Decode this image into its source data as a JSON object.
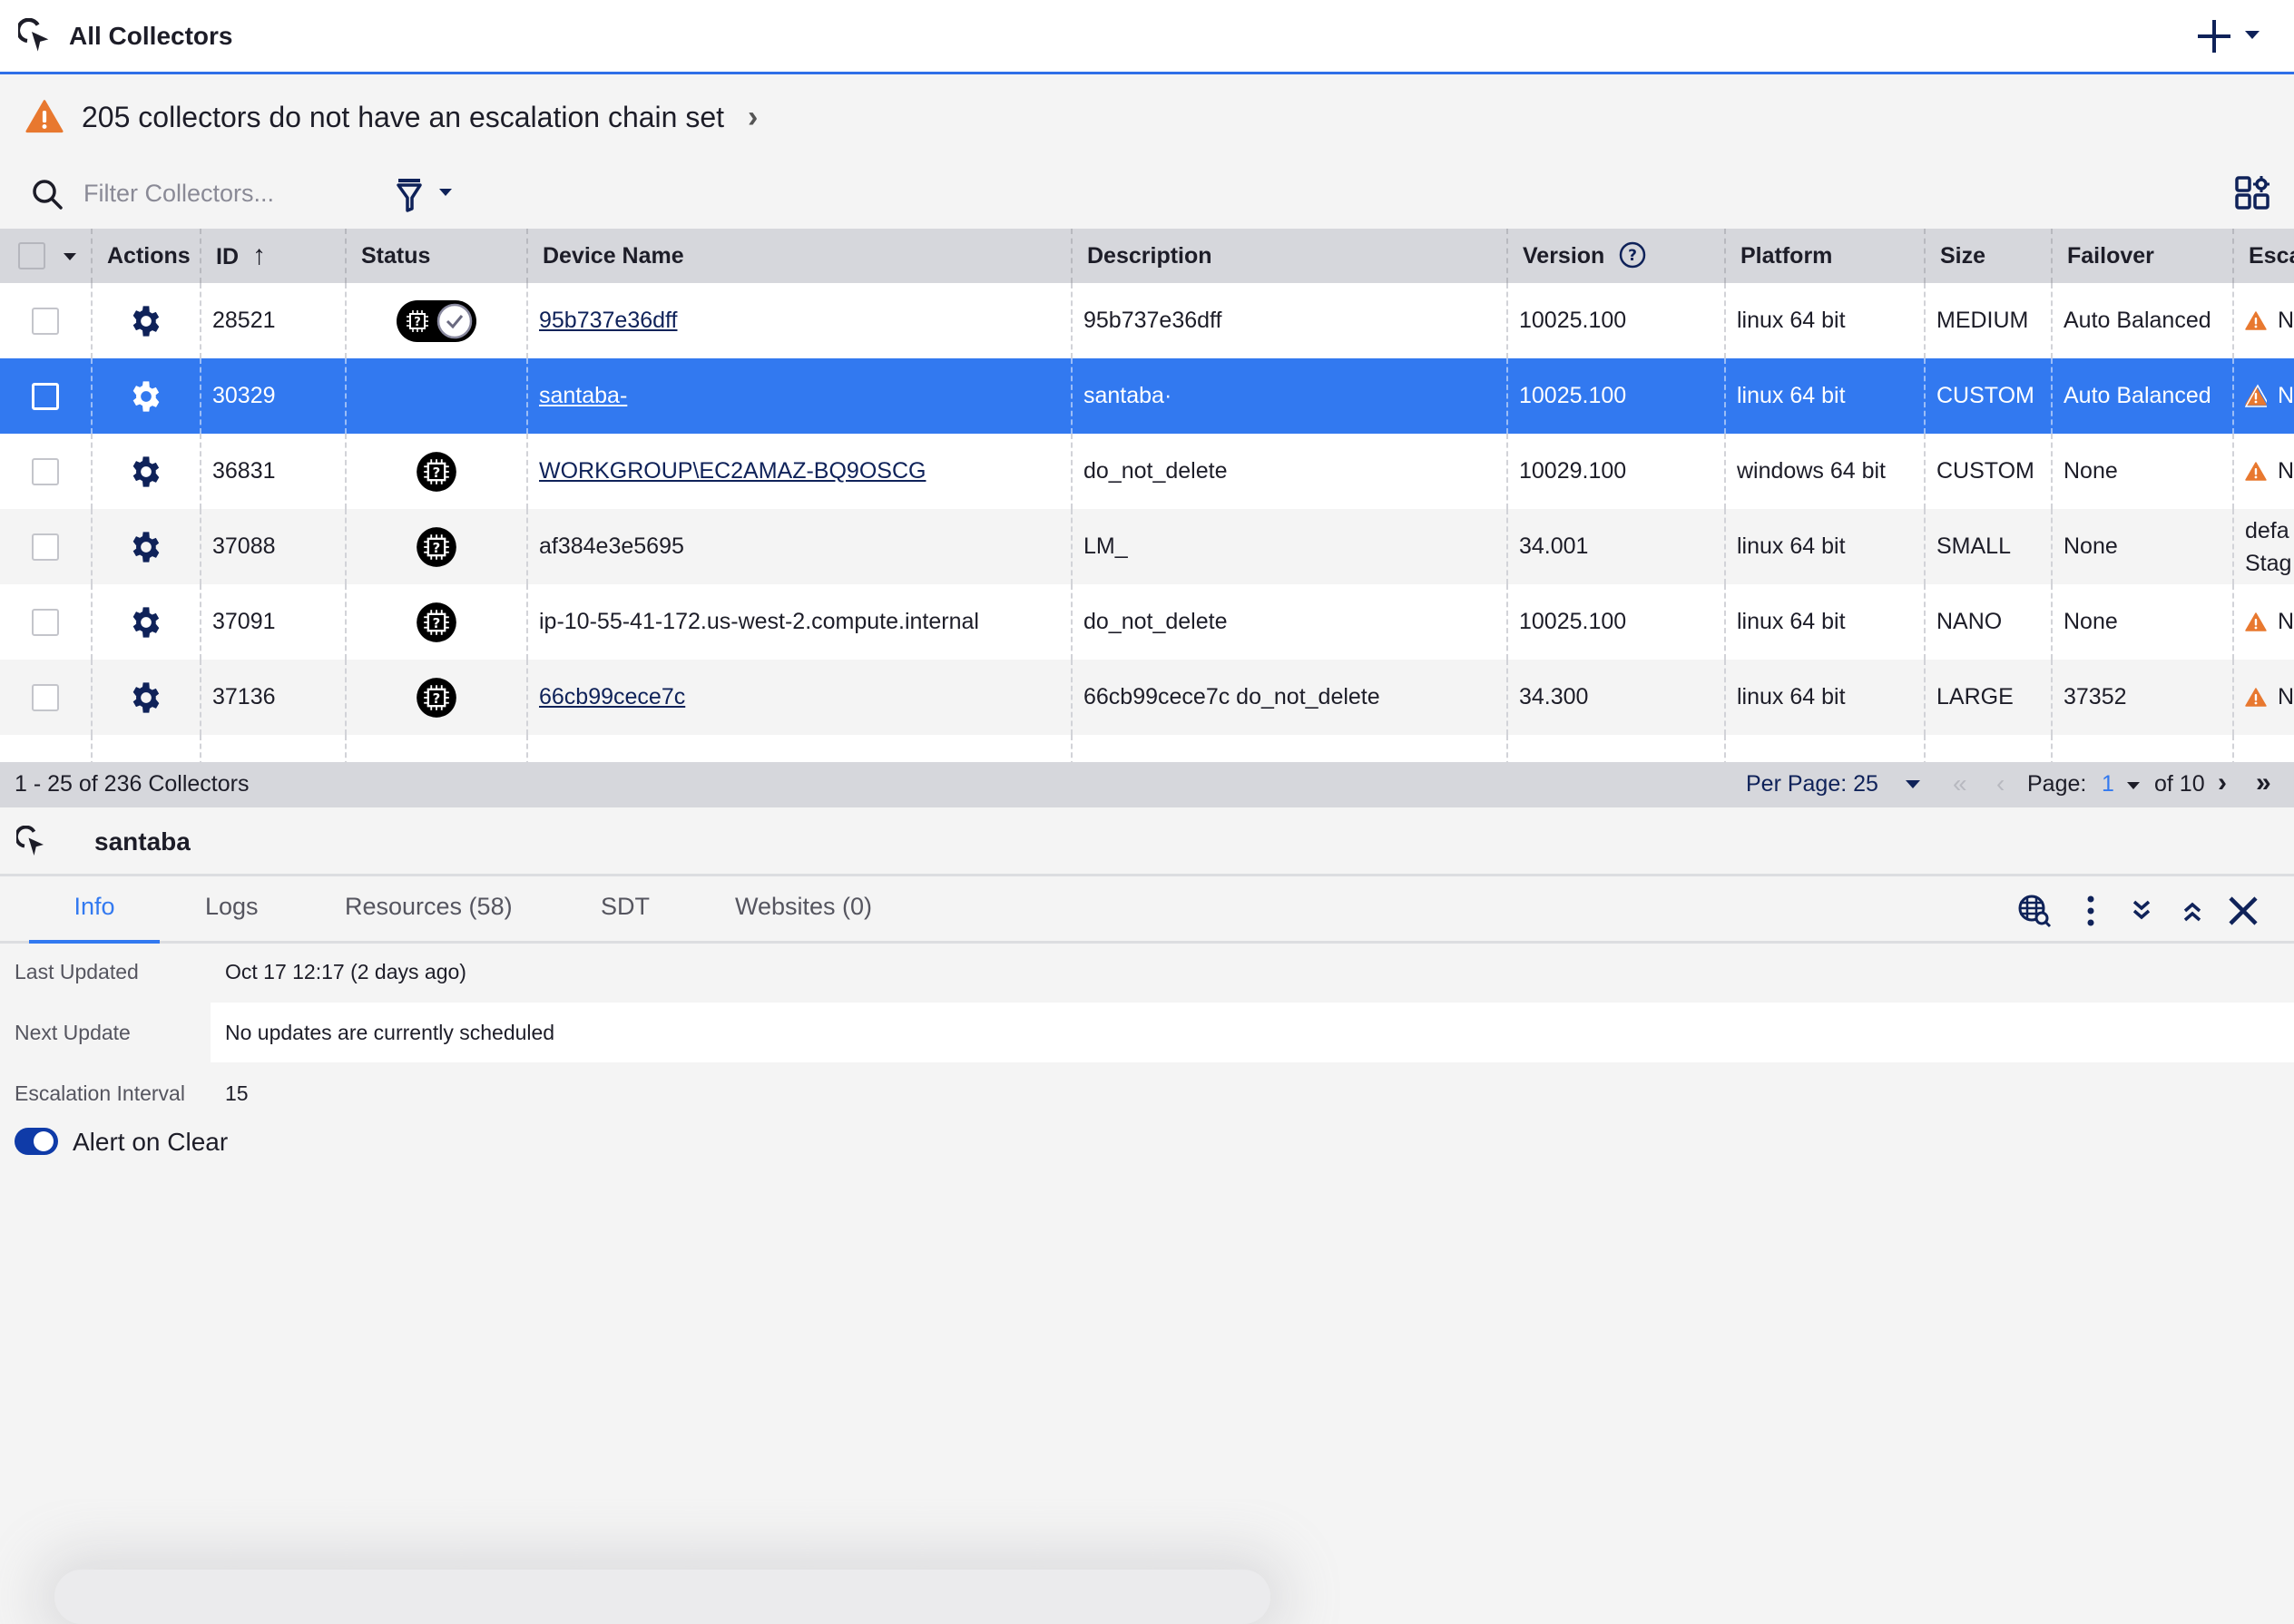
{
  "header": {
    "title": "All Collectors",
    "logo_icon": "collector-logo-icon",
    "add_icon": "plus-icon"
  },
  "banner": {
    "text": "205 collectors do not have an escalation chain set",
    "icon": "warning-triangle-icon",
    "chevron": "›"
  },
  "filter": {
    "placeholder": "Filter Collectors...",
    "value": ""
  },
  "table": {
    "columns": [
      "Actions",
      "ID",
      "Status",
      "Device Name",
      "Description",
      "Version",
      "Platform",
      "Size",
      "Failover",
      "Esca"
    ],
    "sort_indicator": "↑",
    "rows": [
      {
        "id": "28521",
        "status": "down-with-check",
        "device": "95b737e36dff",
        "device_link": true,
        "description": "95b737e36dff",
        "version": "10025.100",
        "platform": "linux 64 bit",
        "size": "MEDIUM",
        "failover": "Auto Balanced",
        "escalation": "N",
        "esc_warn": true,
        "selected": false
      },
      {
        "id": "30329",
        "status": "",
        "device": "santaba-",
        "device_link": true,
        "description": "santaba·",
        "version": "10025.100",
        "platform": "linux 64 bit",
        "size": "CUSTOM",
        "failover": "Auto Balanced",
        "escalation": "N",
        "esc_warn": true,
        "selected": true
      },
      {
        "id": "36831",
        "status": "unknown",
        "device": "WORKGROUP\\EC2AMAZ-BQ9OSCG",
        "device_link": true,
        "description": "do_not_delete",
        "version": "10029.100",
        "platform": "windows 64 bit",
        "size": "CUSTOM",
        "failover": "None",
        "escalation": "N",
        "esc_warn": true,
        "selected": false
      },
      {
        "id": "37088",
        "status": "unknown",
        "device": "af384e3e5695",
        "device_link": false,
        "description": "LM_",
        "version": "34.001",
        "platform": "linux 64 bit",
        "size": "SMALL",
        "failover": "None",
        "escalation": "defa",
        "escalation_line2": "Stag",
        "esc_warn": false,
        "selected": false
      },
      {
        "id": "37091",
        "status": "unknown",
        "device": "ip-10-55-41-172.us-west-2.compute.internal",
        "device_link": false,
        "description": "do_not_delete",
        "version": "10025.100",
        "platform": "linux 64 bit",
        "size": "NANO",
        "failover": "None",
        "escalation": "N",
        "esc_warn": true,
        "selected": false
      },
      {
        "id": "37136",
        "status": "unknown",
        "device": "66cb99cece7c",
        "device_link": true,
        "description": "66cb99cece7c do_not_delete",
        "version": "34.300",
        "platform": "linux 64 bit",
        "size": "LARGE",
        "failover": "37352",
        "escalation": "N",
        "esc_warn": true,
        "selected": false
      }
    ]
  },
  "pagination": {
    "range_text": "1 - 25 of 236 Collectors",
    "per_page_label": "Per Page: 25",
    "page_label": "Page:",
    "current_page": "1",
    "of_text": "of 10",
    "first": "«",
    "prev": "‹",
    "next": "›",
    "last": "»"
  },
  "detail": {
    "name": "santaba",
    "tabs": [
      "Info",
      "Logs",
      "Resources (58)",
      "SDT",
      "Websites (0)"
    ],
    "active_tab": "Info",
    "info": {
      "last_updated_label": "Last Updated",
      "last_updated_value": "Oct 17 12:17  (2 days ago)",
      "next_update_label": "Next Update",
      "next_update_value": "No updates are currently scheduled",
      "escalation_interval_label": "Escalation Interval",
      "escalation_interval_value": "15",
      "alert_on_clear_label": "Alert on Clear",
      "alert_on_clear": true
    }
  },
  "colors": {
    "accent": "#3279f0",
    "navy": "#0f2259",
    "warning": "#e8782f",
    "header_bg": "#d6d7dc",
    "toggle_on": "#0f3ba8"
  }
}
